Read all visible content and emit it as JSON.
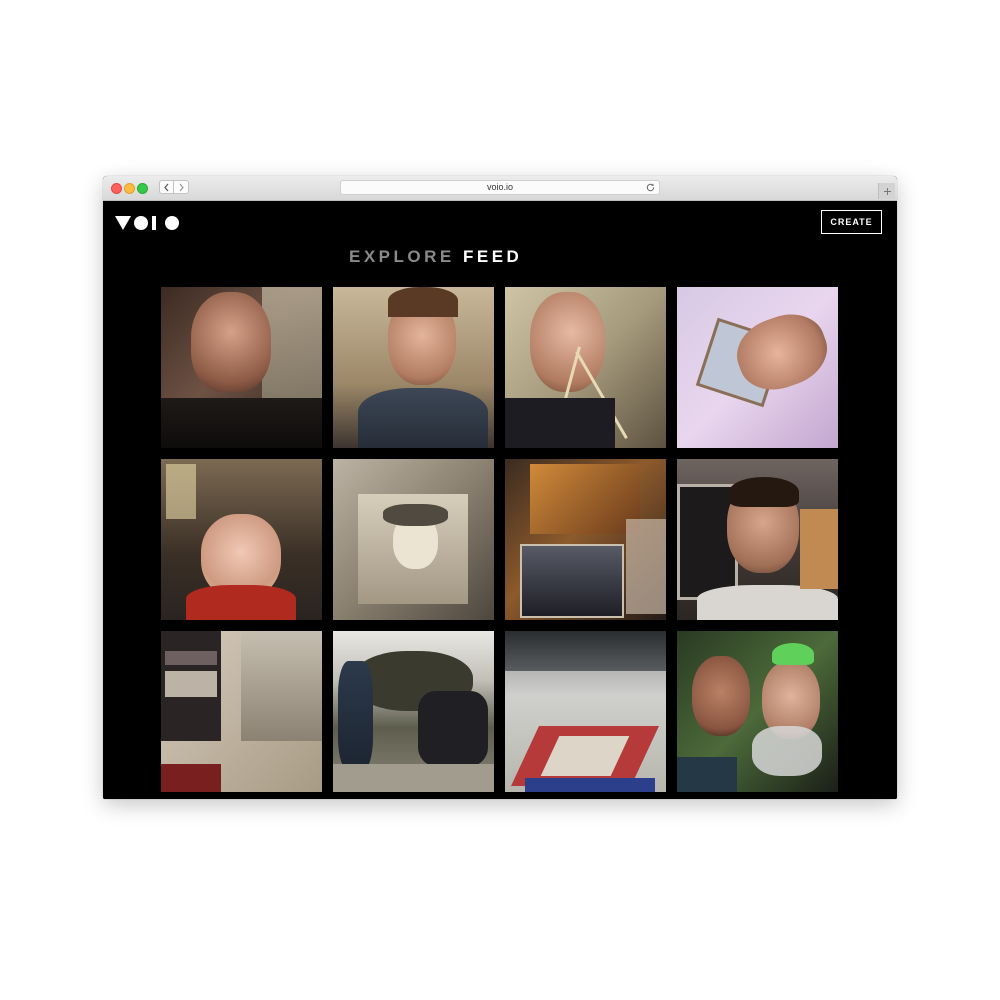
{
  "browser": {
    "url": "voio.io",
    "icons": {
      "back": "chevron-left-icon",
      "forward": "chevron-right-icon",
      "reload": "reload-icon",
      "new_tab": "plus-icon"
    }
  },
  "app": {
    "logo_text": "VOIO",
    "create_label": "CREATE",
    "heading": {
      "part1": "EXPLORE",
      "part2": "FEED"
    },
    "colors": {
      "background": "#000000",
      "heading_muted": "#8a8a8a",
      "heading_bright": "#ffffff"
    }
  },
  "feed": {
    "items": [
      {
        "description": "woman laughing close-up, floral wallpaper"
      },
      {
        "description": "man smiling in restaurant"
      },
      {
        "description": "woman with chopsticks in mouth"
      },
      {
        "description": "man tilted selfie, pink wall"
      },
      {
        "description": "blonde woman smiling in restaurant"
      },
      {
        "description": "old sepia photograph of a person"
      },
      {
        "description": "collage of printed photos"
      },
      {
        "description": "young man by window"
      },
      {
        "description": "posters on a wall"
      },
      {
        "description": "group of friends by rocky hillside"
      },
      {
        "description": "gymnasium with trampolines"
      },
      {
        "description": "two women with festive tinsel"
      }
    ]
  }
}
